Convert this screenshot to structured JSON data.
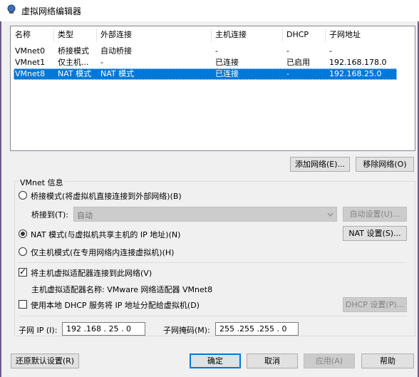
{
  "window": {
    "title": "虚拟网络编辑器"
  },
  "table": {
    "headers": [
      "名称",
      "类型",
      "外部连接",
      "主机连接",
      "DHCP",
      "子网地址"
    ],
    "rows": [
      [
        "VMnet0",
        "桥接模式",
        "自动桥接",
        "-",
        "-",
        "-"
      ],
      [
        "VMnet1",
        "仅主机...",
        "-",
        "已连接",
        "已启用",
        "192.168.178.0"
      ],
      [
        "VMnet8",
        "NAT 模式",
        "NAT 模式",
        "已连接",
        "-",
        "192.168.25.0"
      ]
    ],
    "selected_index": 2
  },
  "buttons": {
    "add_network": "添加网络(E)...",
    "remove_network": "移除网络(O)",
    "auto_settings": "自动设置(U)...",
    "nat_settings": "NAT 设置(S)...",
    "dhcp_settings": "DHCP 设置(P)...",
    "restore_defaults": "还原默认设置(R)",
    "ok": "确定",
    "cancel": "取消",
    "apply": "应用(A)",
    "help": "帮助"
  },
  "vmnet_info": {
    "group_label": "VMnet 信息",
    "bridge_mode": "桥接模式(将虚拟机直接连接到外部网络)(B)",
    "bridge_to_label": "桥接到(T):",
    "bridge_to_value": "自动",
    "nat_mode": "NAT 模式(与虚拟机共享主机的 IP 地址)(N)",
    "host_only_mode": "仅主机模式(在专用网络内连接虚拟机)(H)",
    "selected_mode": "nat",
    "connect_adapter": "将主机虚拟适配器连接到此网络(V)",
    "connect_adapter_checked": true,
    "adapter_name": "主机虚拟适配器名称: VMware 网络适配器 VMnet8",
    "use_dhcp": "使用本地 DHCP 服务将 IP 地址分配给虚拟机(D)",
    "use_dhcp_checked": false,
    "subnet_ip_label": "子网 IP (I):",
    "subnet_ip_value": "192 .168 . 25 . 0",
    "subnet_mask_label": "子网掩码(M):",
    "subnet_mask_value": "255 .255 .255 . 0"
  }
}
